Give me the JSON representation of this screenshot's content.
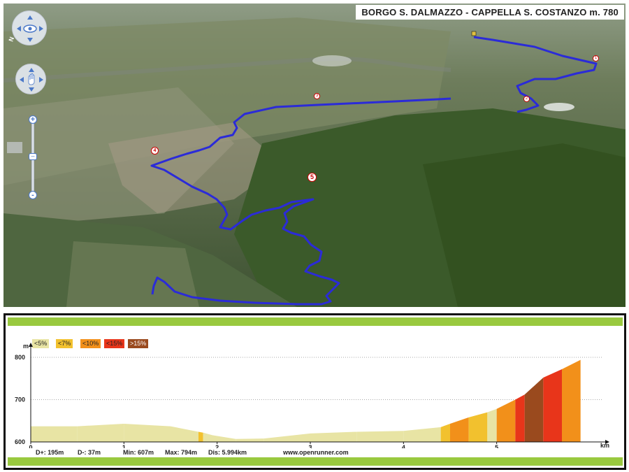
{
  "map": {
    "title": "BORGO S. DALMAZZO - CAPPELLA S. COSTANZO m. 780",
    "compass_letter": "N",
    "markers": [
      "1",
      "2",
      "3",
      "4",
      "5"
    ],
    "controls": {
      "look": "eye-icon",
      "move": "hand-icon",
      "zoom_in": "+",
      "zoom_out": "-"
    }
  },
  "profile": {
    "legend": [
      {
        "label": "<5%",
        "color": "#e8e4a4"
      },
      {
        "label": "<7%",
        "color": "#f2c12e"
      },
      {
        "label": "<10%",
        "color": "#f2901a"
      },
      {
        "label": "<15%",
        "color": "#e8351a"
      },
      {
        "label": ">15%",
        "color": "#9a4a1e"
      }
    ],
    "stats": {
      "dplus": "D+: 195m",
      "dminus": "D-: 37m",
      "min": "Min: 607m",
      "max": "Max: 794m",
      "dis": "Dis: 5.994km",
      "website": "www.openrunner.com"
    },
    "colors": {
      "bar_green": "#99c93f"
    }
  },
  "chart_data": {
    "type": "area",
    "xlabel": "km",
    "ylabel": "m",
    "x_ticks": [
      "0",
      "1",
      "2",
      "3",
      "4",
      "5"
    ],
    "y_ticks": [
      "600",
      "700",
      "800"
    ],
    "xlim": [
      0,
      6
    ],
    "ylim": [
      600,
      800
    ],
    "grid": "horizontal dotted",
    "legend_position": "top-left",
    "points": [
      {
        "x": 0.0,
        "y": 637,
        "grade": "<5%"
      },
      {
        "x": 0.5,
        "y": 637,
        "grade": "<5%"
      },
      {
        "x": 1.0,
        "y": 643,
        "grade": "<5%"
      },
      {
        "x": 1.5,
        "y": 637,
        "grade": "<5%"
      },
      {
        "x": 1.8,
        "y": 624,
        "grade": "<5%"
      },
      {
        "x": 1.85,
        "y": 622,
        "grade": "<7%"
      },
      {
        "x": 1.95,
        "y": 616,
        "grade": "<5%"
      },
      {
        "x": 2.2,
        "y": 607,
        "grade": "<5%"
      },
      {
        "x": 2.5,
        "y": 608,
        "grade": "<5%"
      },
      {
        "x": 3.0,
        "y": 620,
        "grade": "<5%"
      },
      {
        "x": 3.5,
        "y": 624,
        "grade": "<5%"
      },
      {
        "x": 4.0,
        "y": 626,
        "grade": "<5%"
      },
      {
        "x": 4.4,
        "y": 635,
        "grade": "<5%"
      },
      {
        "x": 4.5,
        "y": 643,
        "grade": "<7%"
      },
      {
        "x": 4.7,
        "y": 658,
        "grade": "<10%"
      },
      {
        "x": 4.9,
        "y": 670,
        "grade": "<7%"
      },
      {
        "x": 5.0,
        "y": 678,
        "grade": "<5%"
      },
      {
        "x": 5.2,
        "y": 700,
        "grade": "<10%"
      },
      {
        "x": 5.3,
        "y": 712,
        "grade": "<15%"
      },
      {
        "x": 5.5,
        "y": 752,
        "grade": ">15%"
      },
      {
        "x": 5.7,
        "y": 772,
        "grade": "<15%"
      },
      {
        "x": 5.9,
        "y": 794,
        "grade": "<10%"
      }
    ]
  }
}
